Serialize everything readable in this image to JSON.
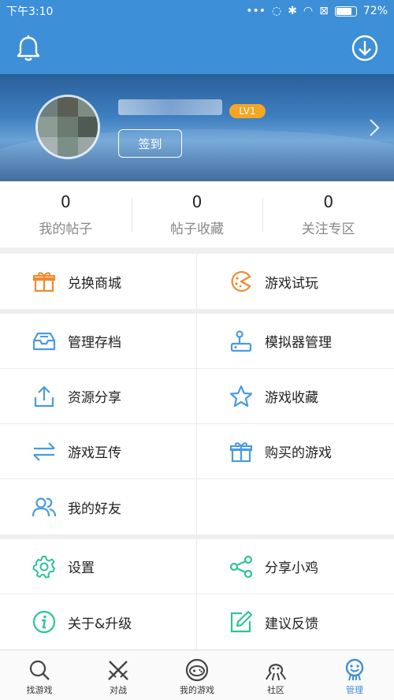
{
  "status_bar": {
    "time": "下午3:10",
    "battery": "72%",
    "battery_level": 0.72
  },
  "profile": {
    "level": "LV1",
    "signin_label": "签到"
  },
  "stats": [
    {
      "value": "0",
      "label": "我的帖子"
    },
    {
      "value": "0",
      "label": "帖子收藏"
    },
    {
      "value": "0",
      "label": "关注专区"
    }
  ],
  "menu": {
    "exchange_mall": "兑换商城",
    "game_trial": "游戏试玩",
    "manage_saves": "管理存档",
    "emulator_manage": "模拟器管理",
    "resource_share": "资源分享",
    "game_favorites": "游戏收藏",
    "game_transfer": "游戏互传",
    "purchased_games": "购买的游戏",
    "my_friends": "我的好友",
    "settings": "设置",
    "share_xiaoji": "分享小鸡",
    "about_upgrade": "关于&升级",
    "feedback": "建议反馈"
  },
  "tabs": [
    {
      "label": "找游戏",
      "icon": "search-icon"
    },
    {
      "label": "对战",
      "icon": "swords-icon"
    },
    {
      "label": "我的游戏",
      "icon": "gamepad-icon"
    },
    {
      "label": "社区",
      "icon": "octopus-icon"
    },
    {
      "label": "管理",
      "icon": "mascot-icon"
    }
  ],
  "colors": {
    "primary": "#3d8fd8",
    "orange": "#f08a2c",
    "blue_icon": "#4a9be0",
    "green": "#2fc49a",
    "badge": "#f5a623"
  }
}
